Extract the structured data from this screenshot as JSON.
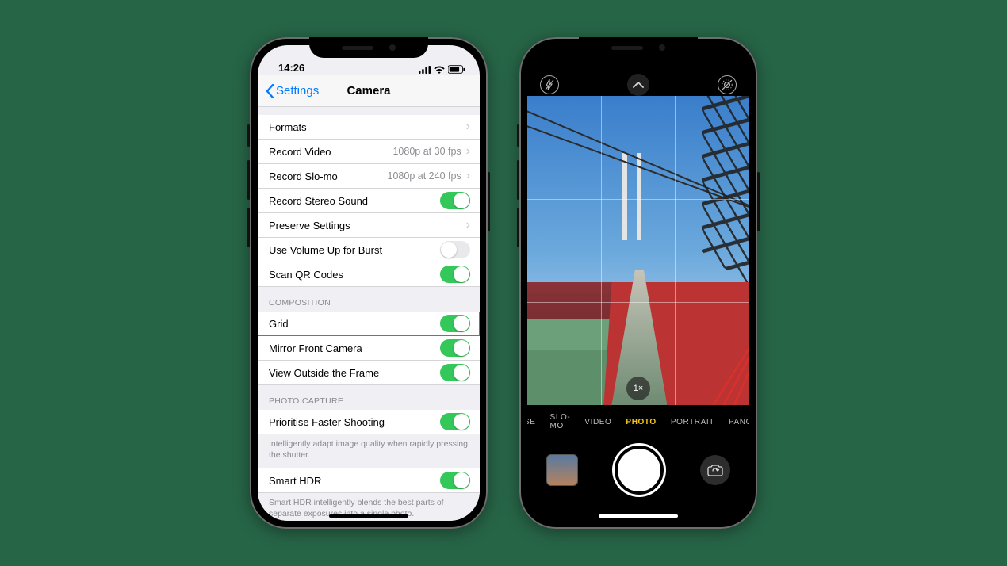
{
  "settings": {
    "time": "14:26",
    "back_label": "Settings",
    "title": "Camera",
    "sections": {
      "main": {
        "formats": "Formats",
        "record_video": "Record Video",
        "record_video_value": "1080p at 30 fps",
        "record_slomo": "Record Slo-mo",
        "record_slomo_value": "1080p at 240 fps",
        "stereo": "Record Stereo Sound",
        "preserve": "Preserve Settings",
        "volume_burst": "Use Volume Up for Burst",
        "qr": "Scan QR Codes"
      },
      "composition": {
        "header": "COMPOSITION",
        "grid": "Grid",
        "mirror": "Mirror Front Camera",
        "outside": "View Outside the Frame"
      },
      "capture": {
        "header": "PHOTO CAPTURE",
        "faster": "Prioritise Faster Shooting",
        "faster_footer": "Intelligently adapt image quality when rapidly pressing the shutter.",
        "hdr": "Smart HDR",
        "hdr_footer": "Smart HDR intelligently blends the best parts of separate exposures into a single photo."
      }
    }
  },
  "camera": {
    "zoom": "1×",
    "modes": {
      "timelapse": "SE",
      "slomo": "SLO-MO",
      "video": "VIDEO",
      "photo": "PHOTO",
      "portrait": "PORTRAIT",
      "pano": "PANO"
    }
  }
}
